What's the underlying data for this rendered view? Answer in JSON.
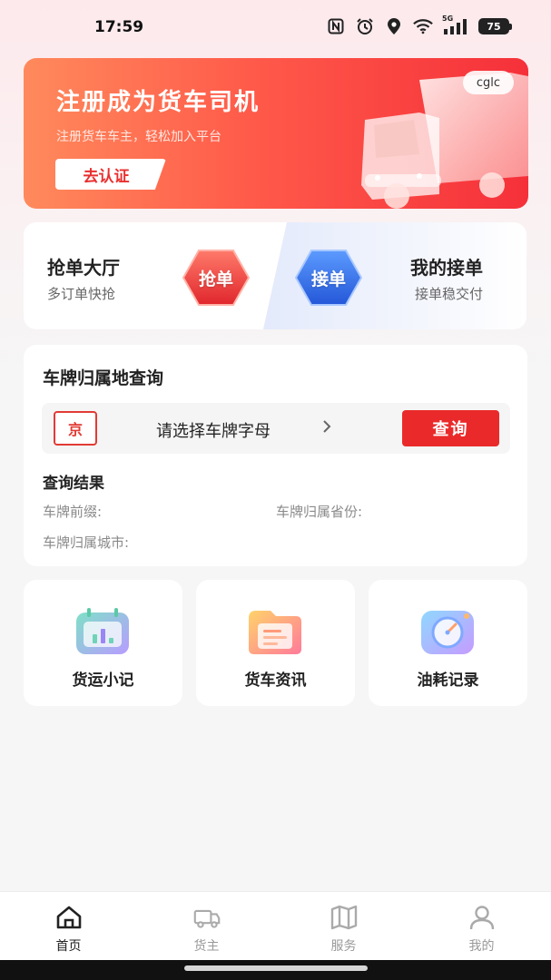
{
  "status_bar": {
    "time": "17:59",
    "network": "5G",
    "battery": "75",
    "icons": [
      "nfc-icon",
      "alarm-icon",
      "location-icon",
      "wifi-icon",
      "signal-icon",
      "battery-icon"
    ]
  },
  "banner": {
    "title": "注册成为货车司机",
    "subtitle": "注册货车车主，轻松加入平台",
    "button_label": "去认证",
    "tag": "cglc"
  },
  "entries": {
    "grab": {
      "title": "抢单大厅",
      "subtitle": "多订单快抢",
      "badge": "抢单",
      "color": "#e83a3a"
    },
    "mine": {
      "title": "我的接单",
      "subtitle": "接单稳交付",
      "badge": "接单",
      "color": "#2f6ee6"
    }
  },
  "plate_query": {
    "title": "车牌归属地查询",
    "province": "京",
    "select_placeholder": "请选择车牌字母",
    "button_label": "查询",
    "result_title": "查询结果",
    "result_labels": {
      "prefix": "车牌前缀:",
      "province": "车牌归属省份:",
      "city": "车牌归属城市:"
    }
  },
  "tools": [
    {
      "label": "货运小记",
      "icon": "calendar-chart-icon"
    },
    {
      "label": "货车资讯",
      "icon": "news-folder-icon"
    },
    {
      "label": "油耗记录",
      "icon": "gauge-icon"
    }
  ],
  "tabbar": [
    {
      "label": "首页",
      "icon": "home-icon",
      "active": true
    },
    {
      "label": "货主",
      "icon": "truck-icon",
      "active": false
    },
    {
      "label": "服务",
      "icon": "map-icon",
      "active": false
    },
    {
      "label": "我的",
      "icon": "user-icon",
      "active": false
    }
  ],
  "colors": {
    "accent_red": "#ea2a2a",
    "accent_blue": "#2f6ee6",
    "banner_start": "#ff8a5c",
    "banner_end": "#f5303a"
  }
}
